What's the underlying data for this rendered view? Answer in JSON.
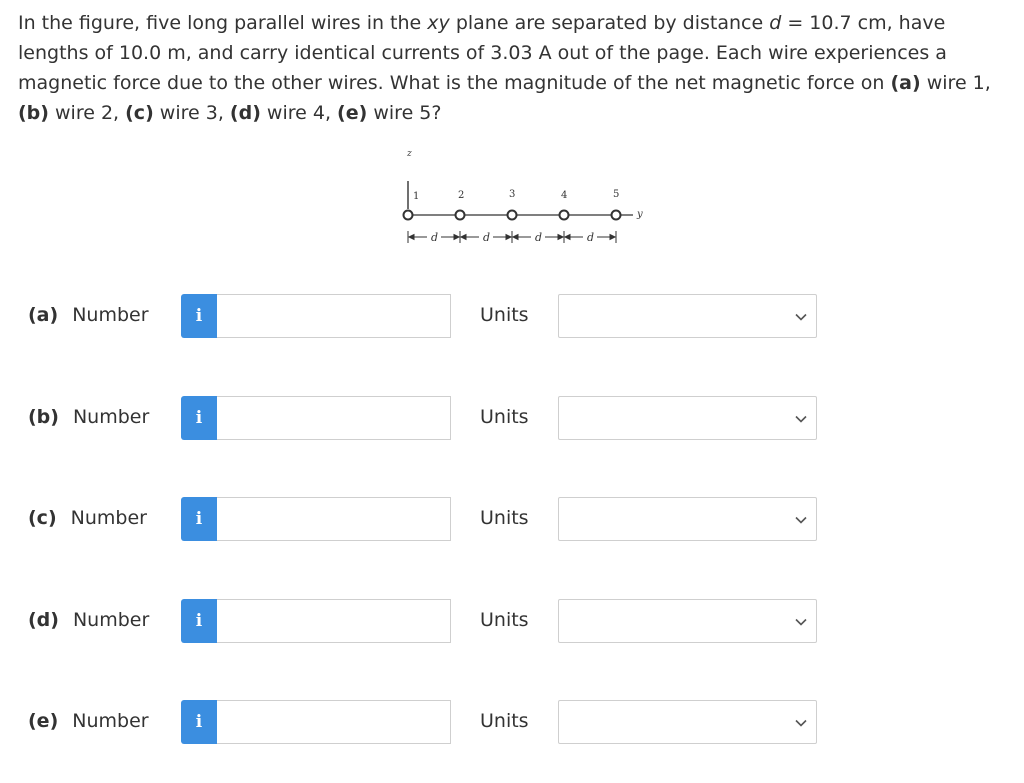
{
  "question": {
    "intro": "In the figure, five long parallel wires in the ",
    "plane_var": "xy",
    "mid1": " plane are separated by distance ",
    "dist_var": "d",
    "mid2": " = 10.7 cm, have lengths of 10.0 m, and carry identical currents of 3.03 A out of the page. Each wire experiences a magnetic force due to the other wires. What is the magnitude of the net magnetic force on ",
    "a": "(a)",
    "a_text": " wire 1, ",
    "b": "(b)",
    "b_text": " wire 2, ",
    "c": "(c)",
    "c_text": " wire 3, ",
    "d": "(d)",
    "d_text": " wire 4, ",
    "e": "(e)",
    "e_text": " wire 5?"
  },
  "figure": {
    "z_axis_label": "z",
    "y_axis_label": "y",
    "distance_label": "d",
    "wires": [
      "1",
      "2",
      "3",
      "4",
      "5"
    ]
  },
  "parts": [
    {
      "letter": "(a)",
      "label": "Number",
      "info_glyph": "i",
      "value": "",
      "units_label": "Units",
      "units_value": ""
    },
    {
      "letter": "(b)",
      "label": "Number",
      "info_glyph": "i",
      "value": "",
      "units_label": "Units",
      "units_value": ""
    },
    {
      "letter": "(c)",
      "label": "Number",
      "info_glyph": "i",
      "value": "",
      "units_label": "Units",
      "units_value": ""
    },
    {
      "letter": "(d)",
      "label": "Number",
      "info_glyph": "i",
      "value": "",
      "units_label": "Units",
      "units_value": ""
    },
    {
      "letter": "(e)",
      "label": "Number",
      "info_glyph": "i",
      "value": "",
      "units_label": "Units",
      "units_value": ""
    }
  ],
  "colors": {
    "info_button": "#3b8ee0",
    "text": "#333333",
    "border": "#cfcfcf"
  }
}
